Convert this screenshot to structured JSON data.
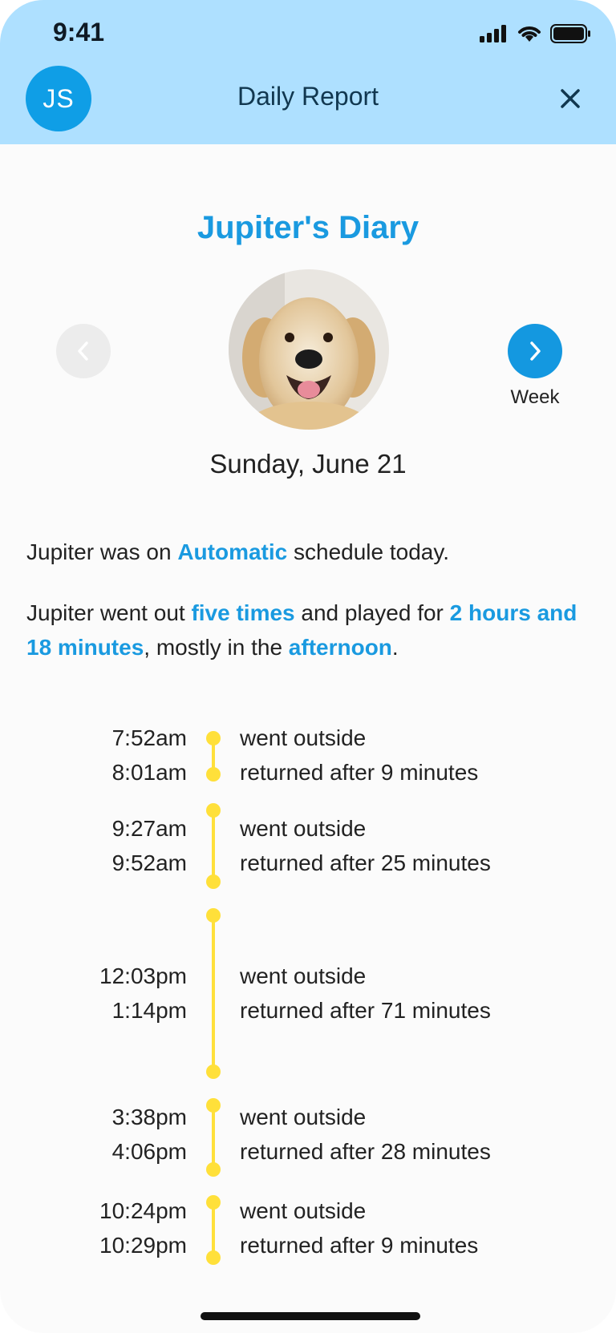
{
  "status_bar": {
    "time": "9:41"
  },
  "header": {
    "avatar_initials": "JS",
    "title": "Daily Report"
  },
  "diary": {
    "title": "Jupiter's Diary",
    "date": "Sunday, June 21",
    "next_label": "Week"
  },
  "summary": {
    "line1": {
      "a": "Jupiter was on ",
      "b": "Automatic",
      "c": " schedule today."
    },
    "line2": {
      "a": "Jupiter went out ",
      "b": "five times",
      "c": " and played for ",
      "d": "2 hours and 18 minutes",
      "e": ", mostly in the ",
      "f": "afternoon",
      "g": "."
    }
  },
  "timeline": [
    {
      "out_time": "7:52am",
      "in_time": "8:01am",
      "out_text": "went outside",
      "in_text": "returned after 9 minutes",
      "duration_minutes": 9
    },
    {
      "out_time": "9:27am",
      "in_time": "9:52am",
      "out_text": "went outside",
      "in_text": "returned after 25 minutes",
      "duration_minutes": 25
    },
    {
      "out_time": "12:03pm",
      "in_time": "1:14pm",
      "out_text": "went outside",
      "in_text": "returned after 71 minutes",
      "duration_minutes": 71
    },
    {
      "out_time": "3:38pm",
      "in_time": "4:06pm",
      "out_text": "went outside",
      "in_text": "returned after 28 minutes",
      "duration_minutes": 28
    },
    {
      "out_time": "10:24pm",
      "in_time": "10:29pm",
      "out_text": "went outside",
      "in_text": "returned after 9 minutes",
      "duration_minutes": 9
    }
  ],
  "colors": {
    "header_bg": "#aee0ff",
    "accent": "#1a9ae0",
    "timeline": "#ffe03a"
  },
  "icons": [
    "signal-icon",
    "wifi-icon",
    "battery-icon",
    "close-icon",
    "chevron-left-icon",
    "chevron-right-icon"
  ]
}
